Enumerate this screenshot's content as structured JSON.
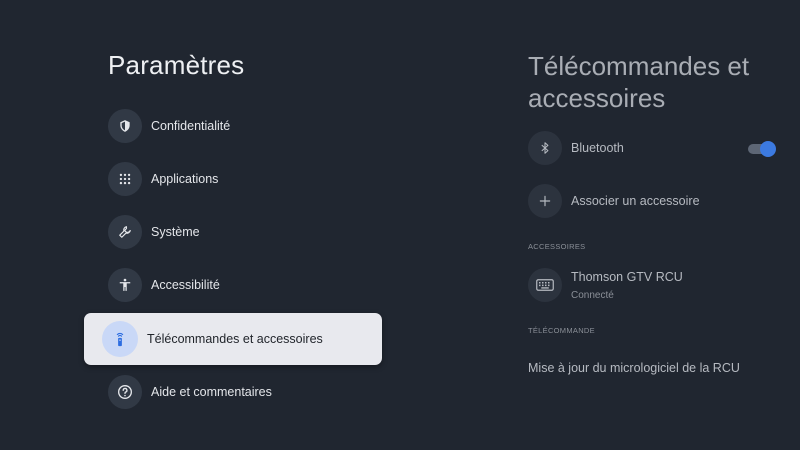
{
  "left_panel": {
    "title": "Paramètres",
    "items": [
      {
        "label": "Confidentialité",
        "icon": "shield-icon"
      },
      {
        "label": "Applications",
        "icon": "apps-grid-icon"
      },
      {
        "label": "Système",
        "icon": "wrench-icon"
      },
      {
        "label": "Accessibilité",
        "icon": "accessibility-icon"
      },
      {
        "label": "Télécommandes et accessoires",
        "icon": "remote-icon",
        "selected": true
      },
      {
        "label": "Aide et commentaires",
        "icon": "help-icon"
      }
    ]
  },
  "right_panel": {
    "title": "Télécommandes et accessoires",
    "bluetooth": {
      "label": "Bluetooth",
      "icon": "bluetooth-icon",
      "enabled": true
    },
    "pair": {
      "label": "Associer un accessoire",
      "icon": "plus-icon"
    },
    "accessories_section": "ACCESSOIRES",
    "device": {
      "name": "Thomson GTV RCU",
      "status": "Connecté",
      "icon": "keyboard-icon"
    },
    "remote_section": "TÉLÉCOMMANDE",
    "firmware_update": "Mise à jour du micrologiciel de la RCU"
  },
  "colors": {
    "background": "#202630",
    "selected_bg": "#e8e9ee",
    "accent": "#3c7ae0"
  }
}
